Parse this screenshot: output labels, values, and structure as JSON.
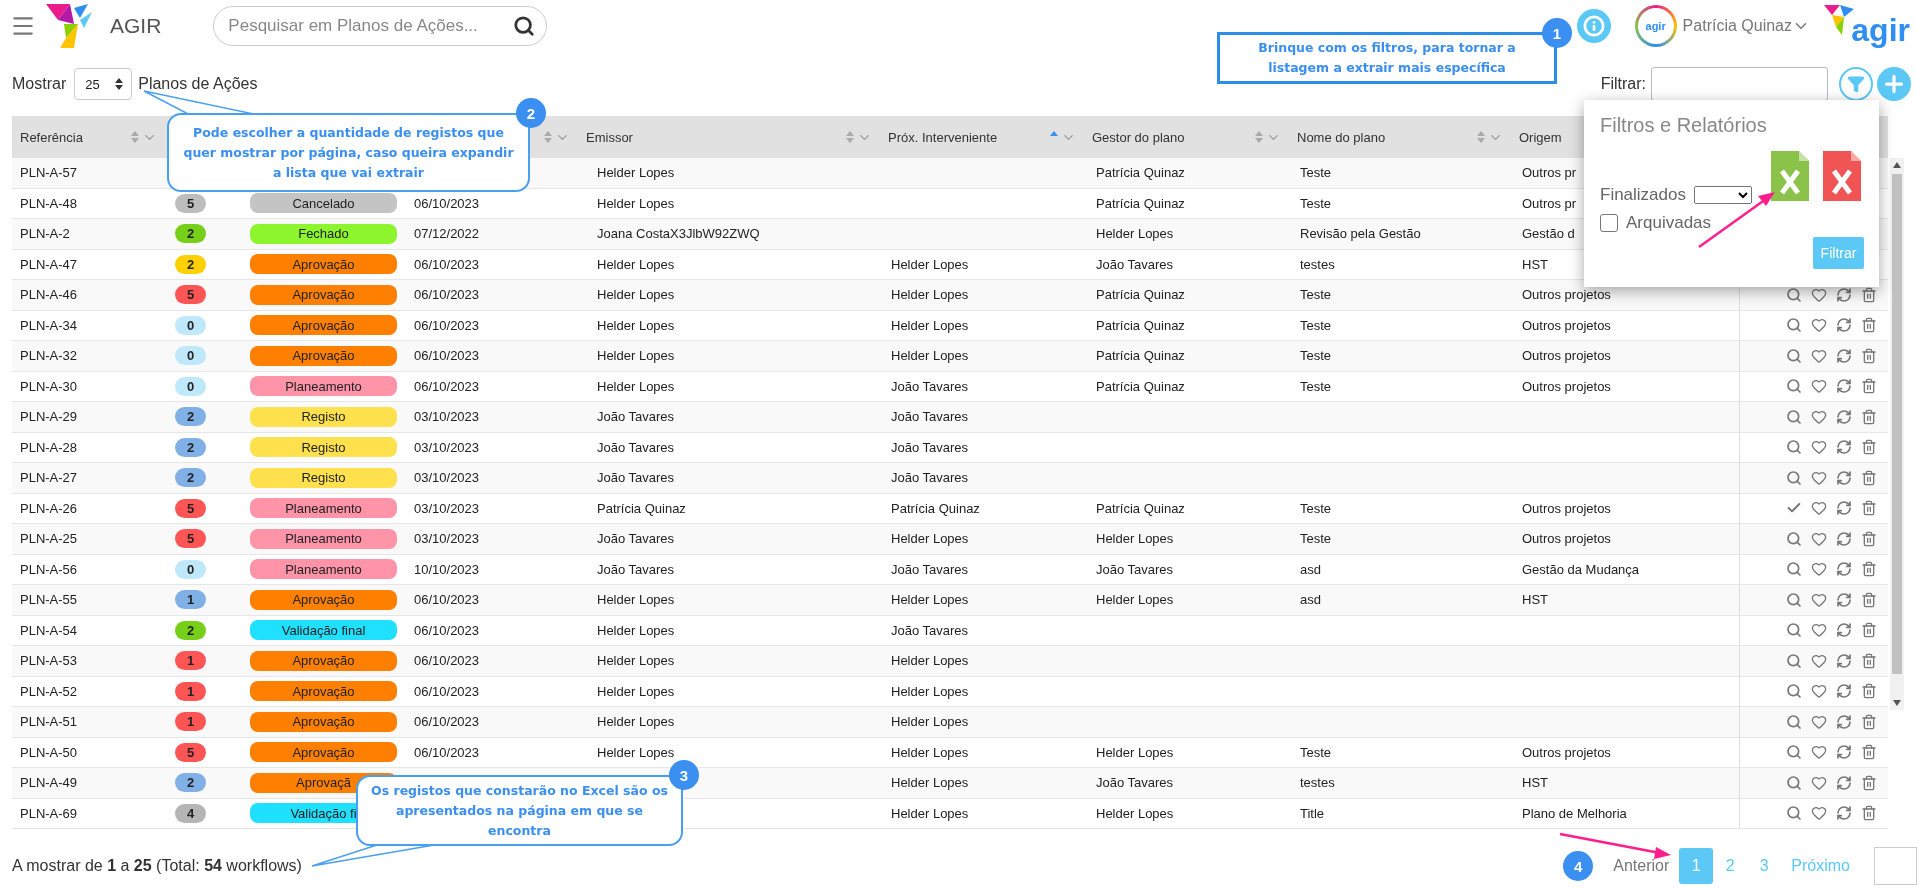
{
  "topbar": {
    "app_name": "AGIR",
    "search": {
      "placeholder": "Pesquisar em Planos de Ações..."
    },
    "user": {
      "avatar_text": "agir",
      "name": "Patrícia Quinaz"
    },
    "logo_text": "agir"
  },
  "toolbar": {
    "show_label": "Mostrar",
    "page_size": "25",
    "show_suffix": "Planos de Ações",
    "filter_label": "Filtrar:"
  },
  "table": {
    "columns": [
      {
        "label": "Referência",
        "sorted_ascending": false
      },
      null,
      null,
      {
        "sorted_ascending": false
      },
      {
        "label": "Emissor",
        "sorted_ascending": false
      },
      {
        "label": "Próx. Interveniente",
        "sorted_ascending": true
      },
      {
        "label": "Gestor do plano",
        "sorted_ascending": false
      },
      {
        "label": "Nome do plano",
        "sorted_ascending": false
      },
      {
        "label": "Origem"
      },
      null
    ],
    "rows": [
      {
        "ref": "PLN-A-57",
        "emissor": "Helder Lopes",
        "gestor": "Patrícia Quinaz",
        "nome": "Teste",
        "origem": "Outros pr"
      },
      {
        "ref": "PLN-A-48",
        "count": {
          "value": "5",
          "color": "#bdbdbd"
        },
        "status": {
          "label": "Cancelado",
          "color": "#c4c4c4"
        },
        "date": "06/10/2023",
        "emissor": "Helder Lopes",
        "gestor": "Patrícia Quinaz",
        "nome": "Teste",
        "origem": "Outros pr"
      },
      {
        "ref": "PLN-A-2",
        "count": {
          "value": "2",
          "color": "#76d01a"
        },
        "status": {
          "label": "Fechado",
          "color": "#8cf52e"
        },
        "date": "07/12/2022",
        "emissor": "Joana CostaX3JlbW92ZWQ",
        "gestor": "Helder Lopes",
        "nome": "Revisão pela Gestão",
        "origem": "Gestão d"
      },
      {
        "ref": "PLN-A-47",
        "count": {
          "value": "2",
          "color": "#ffd000"
        },
        "status": {
          "label": "Aprovação",
          "color": "#ff8000"
        },
        "date": "06/10/2023",
        "emissor": "Helder Lopes",
        "next": "Helder Lopes",
        "gestor": "João Tavares",
        "nome": "testes",
        "origem": "HST"
      },
      {
        "ref": "PLN-A-46",
        "count": {
          "value": "5",
          "color": "#ff5555"
        },
        "status": {
          "label": "Aprovação",
          "color": "#ff8000"
        },
        "date": "06/10/2023",
        "emissor": "Helder Lopes",
        "next": "Helder Lopes",
        "gestor": "Patrícia Quinaz",
        "nome": "Teste",
        "origem": "Outros projetos",
        "done": false
      },
      {
        "ref": "PLN-A-34",
        "count": {
          "value": "0",
          "color": "#bfe9fb"
        },
        "status": {
          "label": "Aprovação",
          "color": "#ff8000"
        },
        "date": "06/10/2023",
        "emissor": "Helder Lopes",
        "next": "Helder Lopes",
        "gestor": "Patrícia Quinaz",
        "nome": "Teste",
        "origem": "Outros projetos",
        "done": false
      },
      {
        "ref": "PLN-A-32",
        "count": {
          "value": "0",
          "color": "#bfe9fb"
        },
        "status": {
          "label": "Aprovação",
          "color": "#ff8000"
        },
        "date": "06/10/2023",
        "emissor": "Helder Lopes",
        "next": "Helder Lopes",
        "gestor": "Patrícia Quinaz",
        "nome": "Teste",
        "origem": "Outros projetos",
        "done": false
      },
      {
        "ref": "PLN-A-30",
        "count": {
          "value": "0",
          "color": "#bfe9fb"
        },
        "status": {
          "label": "Planeamento",
          "color": "#ff94a8"
        },
        "date": "06/10/2023",
        "emissor": "Helder Lopes",
        "next": "João Tavares",
        "gestor": "Patrícia Quinaz",
        "nome": "Teste",
        "origem": "Outros projetos",
        "done": false
      },
      {
        "ref": "PLN-A-29",
        "count": {
          "value": "2",
          "color": "#80b0e6"
        },
        "status": {
          "label": "Registo",
          "color": "#ffe14d"
        },
        "date": "03/10/2023",
        "emissor": "João Tavares",
        "next": "João Tavares",
        "done": false
      },
      {
        "ref": "PLN-A-28",
        "count": {
          "value": "2",
          "color": "#80b0e6"
        },
        "status": {
          "label": "Registo",
          "color": "#ffe14d"
        },
        "date": "03/10/2023",
        "emissor": "João Tavares",
        "next": "João Tavares",
        "done": false
      },
      {
        "ref": "PLN-A-27",
        "count": {
          "value": "2",
          "color": "#80b0e6"
        },
        "status": {
          "label": "Registo",
          "color": "#ffe14d"
        },
        "date": "03/10/2023",
        "emissor": "João Tavares",
        "next": "João Tavares",
        "done": false
      },
      {
        "ref": "PLN-A-26",
        "count": {
          "value": "5",
          "color": "#ff5555"
        },
        "status": {
          "label": "Planeamento",
          "color": "#ff94a8"
        },
        "date": "03/10/2023",
        "emissor": "Patrícia Quinaz",
        "next": "Patrícia Quinaz",
        "gestor": "Patrícia Quinaz",
        "nome": "Teste",
        "origem": "Outros projetos",
        "done": true
      },
      {
        "ref": "PLN-A-25",
        "count": {
          "value": "5",
          "color": "#ff5555"
        },
        "status": {
          "label": "Planeamento",
          "color": "#ff94a8"
        },
        "date": "03/10/2023",
        "emissor": "João Tavares",
        "next": "Helder Lopes",
        "gestor": "Helder Lopes",
        "nome": "Teste",
        "origem": "Outros projetos",
        "done": false
      },
      {
        "ref": "PLN-A-56",
        "count": {
          "value": "0",
          "color": "#bfe9fb"
        },
        "status": {
          "label": "Planeamento",
          "color": "#ff94a8"
        },
        "date": "10/10/2023",
        "emissor": "João Tavares",
        "next": "João Tavares",
        "gestor": "João Tavares",
        "nome": "asd",
        "origem": "Gestão da Mudança",
        "done": false
      },
      {
        "ref": "PLN-A-55",
        "count": {
          "value": "1",
          "color": "#80b0e6"
        },
        "status": {
          "label": "Aprovação",
          "color": "#ff8000"
        },
        "date": "06/10/2023",
        "emissor": "Helder Lopes",
        "next": "Helder Lopes",
        "gestor": "Helder Lopes",
        "nome": "asd",
        "origem": "HST",
        "done": false
      },
      {
        "ref": "PLN-A-54",
        "count": {
          "value": "2",
          "color": "#76d01a"
        },
        "status": {
          "label": "Validação final",
          "color": "#1fe0ff"
        },
        "date": "06/10/2023",
        "emissor": "Helder Lopes",
        "next": "João Tavares",
        "done": false
      },
      {
        "ref": "PLN-A-53",
        "count": {
          "value": "1",
          "color": "#ff5555"
        },
        "status": {
          "label": "Aprovação",
          "color": "#ff8000"
        },
        "date": "06/10/2023",
        "emissor": "Helder Lopes",
        "next": "Helder Lopes",
        "done": false
      },
      {
        "ref": "PLN-A-52",
        "count": {
          "value": "1",
          "color": "#ff5555"
        },
        "status": {
          "label": "Aprovação",
          "color": "#ff8000"
        },
        "date": "06/10/2023",
        "emissor": "Helder Lopes",
        "next": "Helder Lopes",
        "done": false
      },
      {
        "ref": "PLN-A-51",
        "count": {
          "value": "1",
          "color": "#ff5555"
        },
        "status": {
          "label": "Aprovação",
          "color": "#ff8000"
        },
        "date": "06/10/2023",
        "emissor": "Helder Lopes",
        "next": "Helder Lopes",
        "done": false
      },
      {
        "ref": "PLN-A-50",
        "count": {
          "value": "5",
          "color": "#ff5555"
        },
        "status": {
          "label": "Aprovação",
          "color": "#ff8000"
        },
        "date": "06/10/2023",
        "emissor": "Helder Lopes",
        "next": "Helder Lopes",
        "gestor": "Helder Lopes",
        "nome": "Teste",
        "origem": "Outros projetos",
        "done": false
      },
      {
        "ref": "PLN-A-49",
        "count": {
          "value": "2",
          "color": "#80b0e6"
        },
        "status": {
          "label": "Aprovaçã",
          "color": "#ff8000"
        },
        "next": "Helder Lopes",
        "gestor": "João Tavares",
        "nome": "testes",
        "origem": "HST",
        "done": false
      },
      {
        "ref": "PLN-A-69",
        "count": {
          "value": "4",
          "color": "#b5b5b5"
        },
        "status": {
          "label": "Validação fi",
          "color": "#1fe0ff"
        },
        "next": "Helder Lopes",
        "gestor": "Helder Lopes",
        "nome": "Title",
        "origem": "Plano de Melhoria",
        "done": false
      }
    ]
  },
  "filter_popup": {
    "title": "Filtros e Relatórios",
    "finalized_label": "Finalizados",
    "archived": {
      "label": "Arquivadas",
      "checked": false
    },
    "button": "Filtrar"
  },
  "footer": {
    "summary": "A mostrar de **1** a **25** (Total: **54** workflows)"
  },
  "pagination": {
    "step": "4",
    "previous": "Anterior",
    "pages": [
      {
        "label": "1",
        "selected": true
      },
      {
        "label": "2",
        "selected": false
      },
      {
        "label": "3",
        "selected": false
      }
    ],
    "next": "Próximo"
  },
  "callouts": [
    {
      "number": "1",
      "text": "Brinque com os filtros, para tornar a listagem a extrair mais específica"
    },
    {
      "number": "2",
      "text": "Pode escolher a quantidade de registos que quer mostrar por página, caso queira expandir a lista que vai extrair"
    },
    {
      "number": "3",
      "text": "Os registos que constarão no Excel são os apresentados na página em que se encontra"
    }
  ]
}
